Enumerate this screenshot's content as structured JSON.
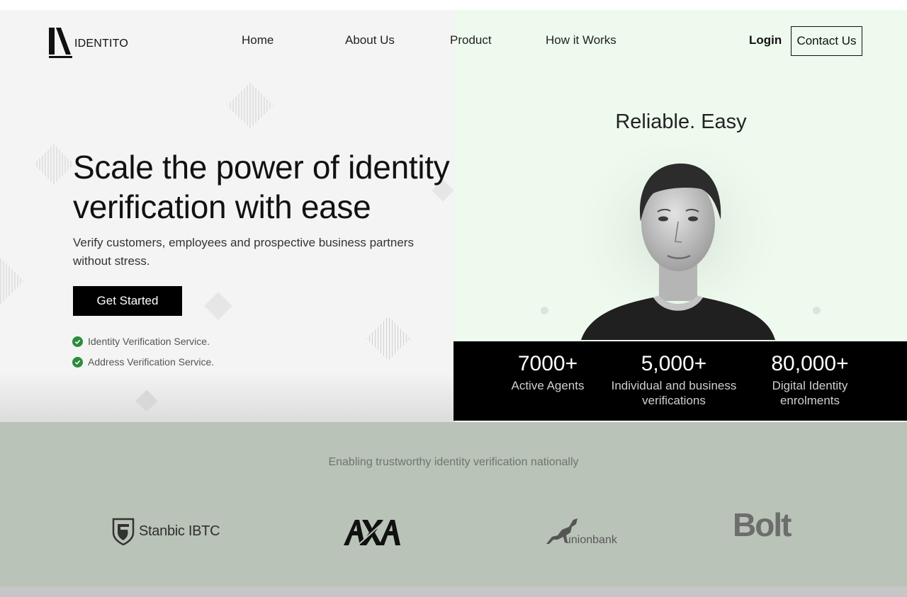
{
  "nav": {
    "logo_text": "IDENTITO",
    "links": [
      "Home",
      "About Us",
      "Product",
      "How it Works"
    ],
    "login_label": "Login",
    "contact_label": "Contact Us"
  },
  "hero": {
    "headline": "Scale the power of identity verification with ease",
    "subtext": "Verify customers, employees and prospective business partners without stress.",
    "cta_label": "Get Started",
    "features": [
      "Identity Verification Service.",
      "Address Verification Service."
    ],
    "tagline": "Reliable. Easy"
  },
  "stats": [
    {
      "value": "7000+",
      "label": "Active Agents"
    },
    {
      "value": "5,000+",
      "label": "Individual and business verifications"
    },
    {
      "value": "80,000+",
      "label": "Digital Identity enrolments"
    }
  ],
  "partners": {
    "caption": "Enabling trustworthy identity verification nationally",
    "logos": [
      {
        "name": "Stanbic IBTC",
        "icon": "shield-icon"
      },
      {
        "name": "AXA",
        "icon": "axa-logo"
      },
      {
        "name": "unionbank",
        "icon": "horse-icon"
      },
      {
        "name": "Bolt",
        "icon": "bolt-logo"
      }
    ]
  },
  "colors": {
    "accent": "#000000",
    "check": "#2e8b3e",
    "hero_right_bg": "#eefaee",
    "partners_bg": "#b9c3b7"
  }
}
